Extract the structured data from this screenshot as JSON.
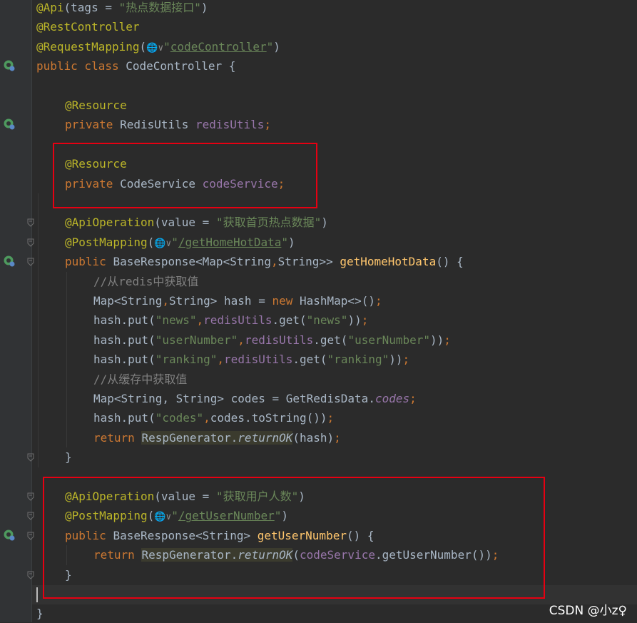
{
  "editor": {
    "lines": [
      {
        "row": 0,
        "indent": 0,
        "tokens": [
          [
            "ann",
            "@Api"
          ],
          [
            "plain",
            "(tags = "
          ],
          [
            "str",
            "\"热点数据接口\""
          ],
          [
            "plain",
            ")"
          ]
        ]
      },
      {
        "row": 1,
        "indent": 0,
        "tokens": [
          [
            "ann",
            "@RestController"
          ]
        ]
      },
      {
        "row": 2,
        "indent": 0,
        "tokens": [
          [
            "ann",
            "@RequestMapping"
          ],
          [
            "plain",
            "("
          ],
          [
            "globe",
            "🌐∨"
          ],
          [
            "str",
            "\""
          ],
          [
            "url",
            "codeController"
          ],
          [
            "str",
            "\""
          ],
          [
            "plain",
            ")"
          ]
        ]
      },
      {
        "row": 3,
        "indent": 0,
        "tokens": [
          [
            "kw",
            "public class "
          ],
          [
            "plain",
            "CodeController {"
          ]
        ]
      },
      {
        "row": 5,
        "indent": 1,
        "tokens": [
          [
            "ann",
            "@Resource"
          ]
        ]
      },
      {
        "row": 6,
        "indent": 1,
        "tokens": [
          [
            "kw",
            "private "
          ],
          [
            "plain",
            "RedisUtils "
          ],
          [
            "fld",
            "redisUtils"
          ],
          [
            "kw",
            ";"
          ]
        ]
      },
      {
        "row": 8,
        "indent": 1,
        "tokens": [
          [
            "ann",
            "@Resource"
          ]
        ]
      },
      {
        "row": 9,
        "indent": 1,
        "tokens": [
          [
            "kw",
            "private "
          ],
          [
            "plain",
            "CodeService "
          ],
          [
            "fld",
            "codeService"
          ],
          [
            "kw",
            ";"
          ]
        ]
      },
      {
        "row": 11,
        "indent": 1,
        "tokens": [
          [
            "ann",
            "@ApiOperation"
          ],
          [
            "plain",
            "(value = "
          ],
          [
            "str",
            "\"获取首页热点数据\""
          ],
          [
            "plain",
            ")"
          ]
        ]
      },
      {
        "row": 12,
        "indent": 1,
        "tokens": [
          [
            "ann",
            "@PostMapping"
          ],
          [
            "plain",
            "("
          ],
          [
            "globe",
            "🌐∨"
          ],
          [
            "str",
            "\""
          ],
          [
            "url",
            "/getHomeHotData"
          ],
          [
            "str",
            "\""
          ],
          [
            "plain",
            ")"
          ]
        ]
      },
      {
        "row": 13,
        "indent": 1,
        "tokens": [
          [
            "kw",
            "public "
          ],
          [
            "plain",
            "BaseResponse<Map<String"
          ],
          [
            "kw",
            ","
          ],
          [
            "plain",
            "String>> "
          ],
          [
            "fn",
            "getHomeHotData"
          ],
          [
            "plain",
            "() {"
          ]
        ]
      },
      {
        "row": 14,
        "indent": 2,
        "tokens": [
          [
            "cm",
            "//从redis中获取值"
          ]
        ]
      },
      {
        "row": 15,
        "indent": 2,
        "tokens": [
          [
            "plain",
            "Map<String"
          ],
          [
            "kw",
            ","
          ],
          [
            "plain",
            "String> hash = "
          ],
          [
            "kw",
            "new "
          ],
          [
            "plain",
            "HashMap<>()"
          ],
          [
            "kw",
            ";"
          ]
        ]
      },
      {
        "row": 16,
        "indent": 2,
        "tokens": [
          [
            "plain",
            "hash.put("
          ],
          [
            "str",
            "\"news\""
          ],
          [
            "kw",
            ","
          ],
          [
            "fld",
            "redisUtils"
          ],
          [
            "plain",
            ".get("
          ],
          [
            "str",
            "\"news\""
          ],
          [
            "plain",
            "))"
          ],
          [
            "kw",
            ";"
          ]
        ]
      },
      {
        "row": 17,
        "indent": 2,
        "tokens": [
          [
            "plain",
            "hash.put("
          ],
          [
            "str",
            "\"userNumber\""
          ],
          [
            "kw",
            ","
          ],
          [
            "fld",
            "redisUtils"
          ],
          [
            "plain",
            ".get("
          ],
          [
            "str",
            "\"userNumber\""
          ],
          [
            "plain",
            "))"
          ],
          [
            "kw",
            ";"
          ]
        ]
      },
      {
        "row": 18,
        "indent": 2,
        "tokens": [
          [
            "plain",
            "hash.put("
          ],
          [
            "str",
            "\"ranking\""
          ],
          [
            "kw",
            ","
          ],
          [
            "fld",
            "redisUtils"
          ],
          [
            "plain",
            ".get("
          ],
          [
            "str",
            "\"ranking\""
          ],
          [
            "plain",
            "))"
          ],
          [
            "kw",
            ";"
          ]
        ]
      },
      {
        "row": 19,
        "indent": 2,
        "tokens": [
          [
            "cm",
            "//从缓存中获取值"
          ]
        ]
      },
      {
        "row": 20,
        "indent": 2,
        "tokens": [
          [
            "plain",
            "Map<String, String> codes = GetRedisData."
          ],
          [
            "st",
            "codes"
          ],
          [
            "kw",
            ";"
          ]
        ]
      },
      {
        "row": 21,
        "indent": 2,
        "tokens": [
          [
            "plain",
            "hash.put("
          ],
          [
            "str",
            "\"codes\""
          ],
          [
            "kw",
            ","
          ],
          [
            "plain",
            "codes.toString())"
          ],
          [
            "kw",
            ";"
          ]
        ]
      },
      {
        "row": 22,
        "indent": 2,
        "tokens": [
          [
            "kw",
            "return "
          ],
          [
            "hl",
            "RespGenerator."
          ],
          [
            "hlstm",
            "returnOK"
          ],
          [
            "plain",
            "(hash)"
          ],
          [
            "kw",
            ";"
          ]
        ]
      },
      {
        "row": 23,
        "indent": 1,
        "tokens": [
          [
            "plain",
            "}"
          ]
        ]
      },
      {
        "row": 25,
        "indent": 1,
        "tokens": [
          [
            "ann",
            "@ApiOperation"
          ],
          [
            "plain",
            "(value = "
          ],
          [
            "str",
            "\"获取用户人数\""
          ],
          [
            "plain",
            ")"
          ]
        ]
      },
      {
        "row": 26,
        "indent": 1,
        "tokens": [
          [
            "ann",
            "@PostMapping"
          ],
          [
            "plain",
            "("
          ],
          [
            "globe",
            "🌐∨"
          ],
          [
            "str",
            "\""
          ],
          [
            "url",
            "/getUserNumber"
          ],
          [
            "str",
            "\""
          ],
          [
            "plain",
            ")"
          ]
        ]
      },
      {
        "row": 27,
        "indent": 1,
        "tokens": [
          [
            "kw",
            "public "
          ],
          [
            "plain",
            "BaseResponse<String> "
          ],
          [
            "fn",
            "getUserNumber"
          ],
          [
            "plain",
            "() {"
          ]
        ]
      },
      {
        "row": 28,
        "indent": 2,
        "tokens": [
          [
            "kw",
            "return "
          ],
          [
            "hl",
            "RespGenerator."
          ],
          [
            "hlstm",
            "returnOK"
          ],
          [
            "plain",
            "("
          ],
          [
            "fld",
            "codeService"
          ],
          [
            "plain",
            ".getUserNumber())"
          ],
          [
            "kw",
            ";"
          ]
        ]
      },
      {
        "row": 29,
        "indent": 1,
        "tokens": [
          [
            "plain",
            "}"
          ]
        ]
      },
      {
        "row": 31,
        "indent": 0,
        "tokens": [
          [
            "plain",
            "}"
          ]
        ]
      }
    ]
  },
  "gutter": {
    "bean_icon_rows": [
      3,
      6,
      13,
      27
    ],
    "bean_icon_color": "#4e9a5e",
    "fold_rows": [
      11,
      12,
      13,
      23,
      25,
      26,
      27,
      29
    ]
  },
  "watermark": "CSDN @小z♀",
  "colors": {
    "background": "#2b2b2b",
    "highlight_box": "#e60012"
  }
}
